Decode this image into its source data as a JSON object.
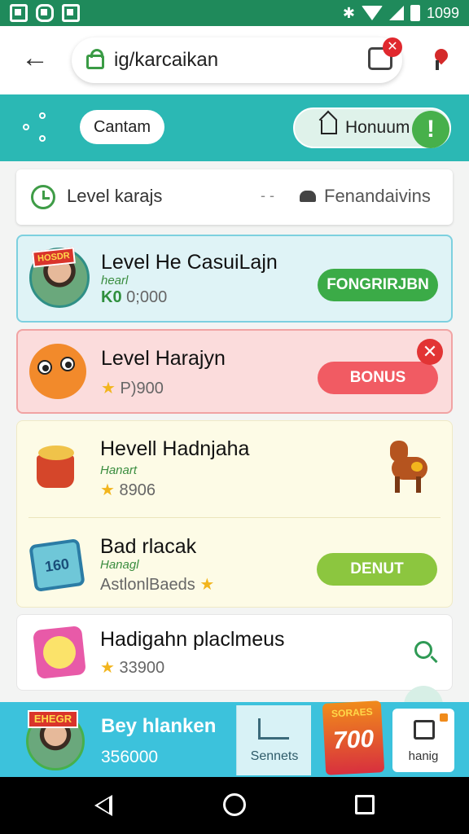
{
  "status_bar": {
    "time": "1099"
  },
  "browser": {
    "url": "ig/karcaikan",
    "tab_badge": "✕"
  },
  "header": {
    "pill_left": "Cantam",
    "home_label": "Honuum",
    "alert_mark": "!"
  },
  "level_bar": {
    "label": "Level karajs",
    "dash": "- -",
    "right_label": "Fenandaivins"
  },
  "cards": [
    {
      "title": "Level He CasuiLajn",
      "badge": "HOSDR",
      "sub": "hearl",
      "value_prefix": "K0",
      "value": "0;000",
      "button": "FONGRIRJBN",
      "button_color": "#3bab47"
    },
    {
      "title": "Level Harajyn",
      "value": "P)900",
      "button": "BONUS",
      "button_color": "#f15b63",
      "close": "✕"
    },
    {
      "title": "Hevell Hadnjaha",
      "sub": "Hanart",
      "value": "8906"
    },
    {
      "title": "Bad rlacak",
      "sub": "Hanagl",
      "value": "AstlonlBaeds",
      "tablet_text": "160",
      "button": "DENUT",
      "button_color": "#8cc63f"
    },
    {
      "title": "Hadigahn placlmeus",
      "value": "33900"
    }
  ],
  "bottom_bar": {
    "badge": "EHEGR",
    "user_name": "Bey hlanken",
    "user_points": "356000",
    "services_label": "Sennets",
    "services_icon": "LPP",
    "scores_label": "SORAES",
    "scores_value": "700",
    "hang_label": "hanig"
  }
}
